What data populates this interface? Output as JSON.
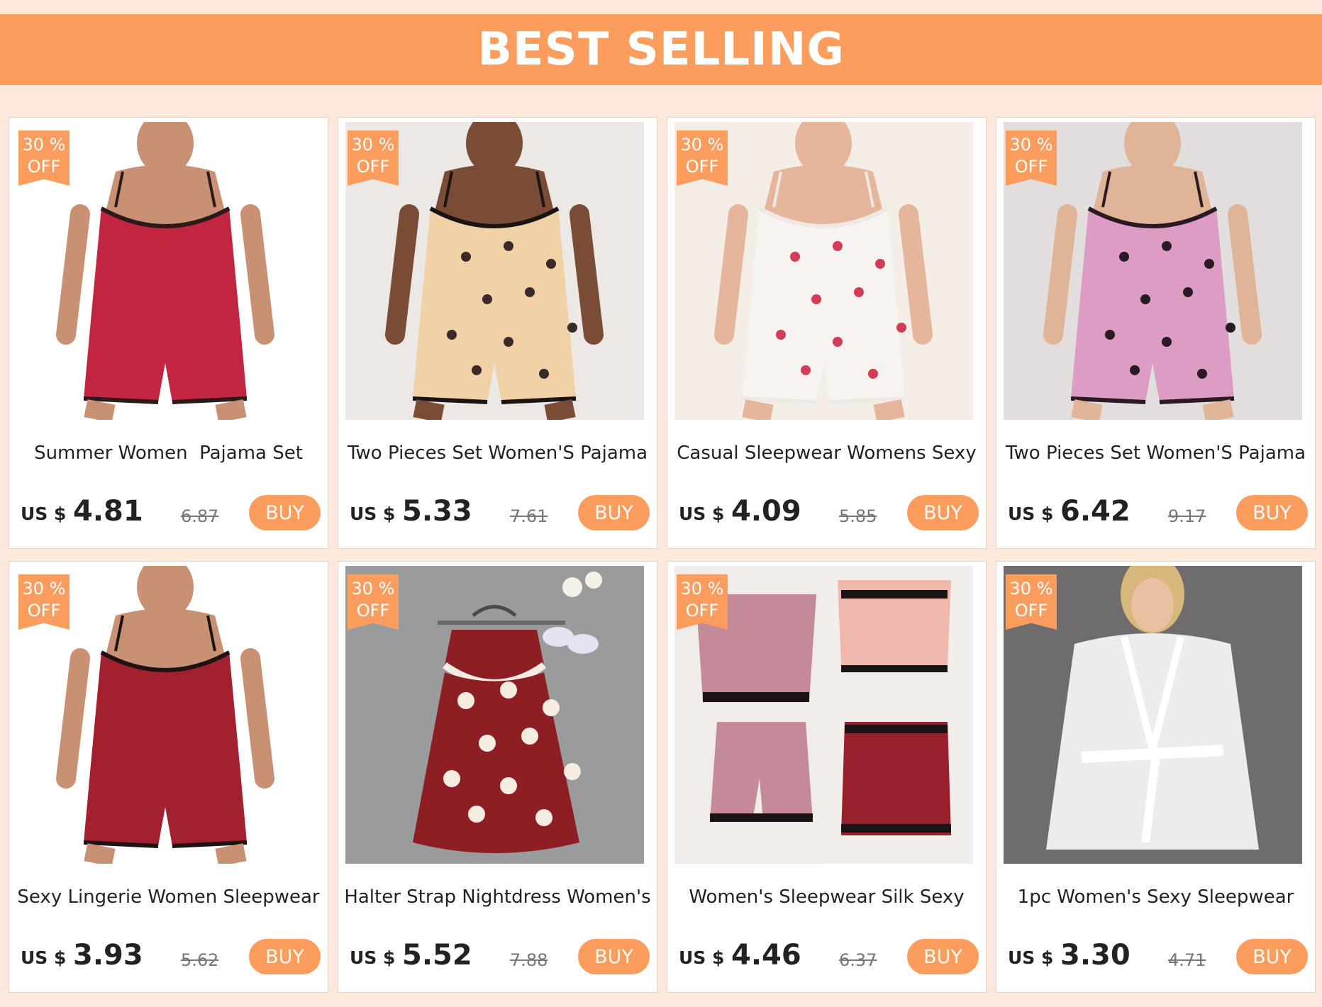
{
  "banner": {
    "title": "BEST SELLING"
  },
  "badge": {
    "line1": "30 %",
    "line2": "OFF"
  },
  "currency_label": "US $",
  "buy_label": "BUY",
  "colors": {
    "accent": "#fd9d5d",
    "page_bg": "#fde9dc"
  },
  "products": [
    {
      "name": "Summer Women  Pajama Set",
      "price": "4.81",
      "old_price": "6.87",
      "image": "red satin cami and shorts set",
      "bg": "#ffffff",
      "garment": "#c2253f",
      "trim": "#2b1a1a",
      "dots": "",
      "skin": "#c99174"
    },
    {
      "name": "Two Pieces Set Women'S Pajama",
      "price": "5.33",
      "old_price": "7.61",
      "image": "cream love-print satin cami set",
      "bg": "#ece8e6",
      "garment": "#f0d2a6",
      "trim": "#1a1414",
      "dots": "#3a2a2a",
      "skin": "#7a4b35"
    },
    {
      "name": "Casual Sleepwear Womens Sexy",
      "price": "4.09",
      "old_price": "5.85",
      "image": "white rose-print satin cami set",
      "bg": "#f4eee6",
      "garment": "#f7f3f0",
      "trim": "#f0e8e4",
      "dots": "#d23c55",
      "skin": "#e5b69b"
    },
    {
      "name": "Two Pieces Set Women'S Pajama",
      "price": "6.42",
      "old_price": "9.17",
      "image": "pink bow-print cami set",
      "bg": "#e2dedd",
      "garment": "#dc9cc3",
      "trim": "#2a1a24",
      "dots": "#2a1a24",
      "skin": "#e0b497"
    },
    {
      "name": "Sexy Lingerie Women Sleepwear",
      "price": "3.93",
      "old_price": "5.62",
      "image": "burgundy lace-trim cami romper",
      "bg": "#ffffff",
      "garment": "#a3202f",
      "trim": "#1e1212",
      "dots": "",
      "skin": "#c99174"
    },
    {
      "name": "Halter Strap Nightdress Women's",
      "price": "5.52",
      "old_price": "7.88",
      "image": "polka dot satin nightdress on hanger",
      "bg": "#9a9b9d",
      "garment": "#8d1f24",
      "trim": "#f4ece4",
      "dots": "#f6ece2",
      "skin": ""
    },
    {
      "name": "Women's Sleepwear Silk Sexy",
      "price": "4.46",
      "old_price": "6.37",
      "image": "pink and black lace satin sets",
      "bg": "#efece9",
      "garment": "#c48a98",
      "trim": "#1a1414",
      "dots": "",
      "skin": ""
    },
    {
      "name": "1pc Women's Sexy Sleepwear",
      "price": "3.30",
      "old_price": "4.71",
      "image": "white sheer lace robe",
      "bg": "#6e6c6c",
      "garment": "#f6f4f4",
      "trim": "#ffffff",
      "dots": "",
      "skin": "#e9c1a2"
    }
  ]
}
